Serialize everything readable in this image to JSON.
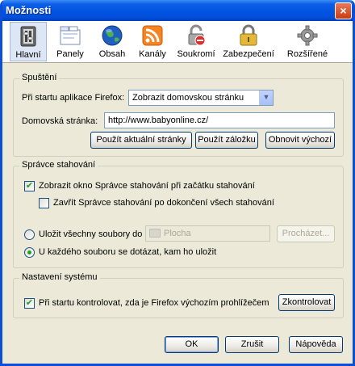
{
  "window": {
    "title": "Možnosti",
    "close_glyph": "×"
  },
  "toolbar": {
    "selected": "Hlavní",
    "items": [
      {
        "label": "Hlavní",
        "icon": "main-switch-icon"
      },
      {
        "label": "Panely",
        "icon": "tabs-icon"
      },
      {
        "label": "Obsah",
        "icon": "globe-icon"
      },
      {
        "label": "Kanály",
        "icon": "rss-icon"
      },
      {
        "label": "Soukromí",
        "icon": "privacy-lock-icon"
      },
      {
        "label": "Zabezpečení",
        "icon": "padlock-icon"
      },
      {
        "label": "Rozšířené",
        "icon": "gear-icon"
      }
    ]
  },
  "startup": {
    "group_title": "Spuštění",
    "when_start_label": "Při startu aplikace Firefox:",
    "when_start_value": "Zobrazit domovskou stránku",
    "homepage_label": "Domovská stránka:",
    "homepage_value": "http://www.babyonline.cz/",
    "use_current_button": "Použít aktuální stránky",
    "use_bookmark_button": "Použít záložku",
    "restore_default_button": "Obnovit výchozí"
  },
  "downloads": {
    "group_title": "Správce stahování",
    "show_window_label": "Zobrazit okno Správce stahování při začátku stahování",
    "show_window_checked": true,
    "close_window_label": "Zavřít Správce stahování po dokončení všech stahování",
    "close_window_checked": false,
    "save_to_label": "Uložit všechny soubory do",
    "save_to_folder": "Plocha",
    "browse_button": "Procházet...",
    "ask_label": "U každého souboru se dotázat, kam ho uložit",
    "selected_option": "ask"
  },
  "system": {
    "group_title": "Nastavení systému",
    "check_default_label": "Při startu kontrolovat, zda je Firefox výchozím prohlížečem",
    "check_default_checked": true,
    "check_now_button": "Zkontrolovat"
  },
  "footer": {
    "ok_button": "OK",
    "cancel_button": "Zrušit",
    "help_button": "Nápověda"
  },
  "colors": {
    "titlebar": "#0353e3",
    "dialog_bg": "#ece9d8",
    "check_mark": "#21a121"
  }
}
